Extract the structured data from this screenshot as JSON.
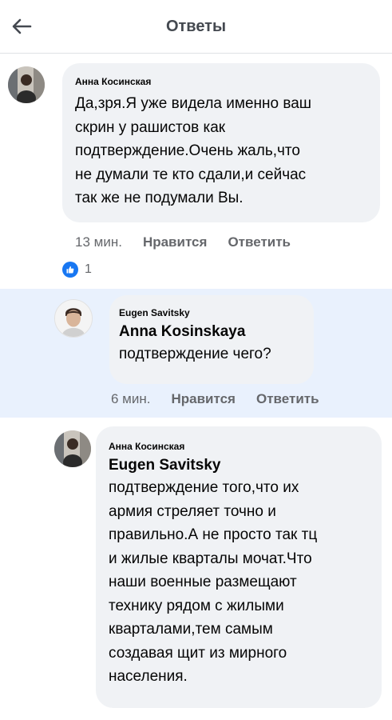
{
  "header": {
    "title": "Ответы"
  },
  "icons": {
    "back": "back-arrow-icon",
    "like": "like-thumb-icon"
  },
  "colors": {
    "accent": "#1877f2",
    "bubble": "#f0f2f5",
    "highlight": "#e9f1fd",
    "secondary_text": "#65676b"
  },
  "comments": [
    {
      "author": "Анна Косинская",
      "text": "Да,зря.Я уже видела именно ваш\nскрин у рашистов как\nподтверждение.Очень жаль,что\nне думали те кто сдали,и сейчас\nтак же не подумали Вы.",
      "time": "13 мин.",
      "like": "Нравится",
      "reply": "Ответить",
      "reaction_count": "1"
    },
    {
      "author": "Eugen Savitsky",
      "mention": "Anna Kosinskaya",
      "text": "подтверждение чего?",
      "time": "6 мин.",
      "like": "Нравится",
      "reply": "Ответить"
    },
    {
      "author": "Анна Косинская",
      "mention": "Eugen Savitsky",
      "text": "подтверждение того,что их\nармия стреляет точно и\nправильно.А не просто так тц\nи жилые кварталы мочат.Что\nнаши военные размещают\nтехнику рядом с жилыми\nкварталами,тем самым\nсоздавая щит из мирного\nнаселения."
    }
  ]
}
